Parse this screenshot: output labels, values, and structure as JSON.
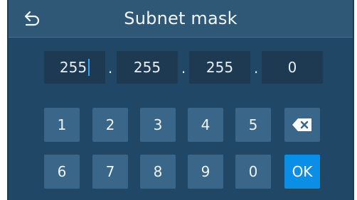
{
  "header": {
    "title": "Subnet mask",
    "back_icon": "back-arrow-icon"
  },
  "ip": {
    "octets": [
      "255",
      "255",
      "255",
      "0"
    ],
    "separator": "."
  },
  "keypad": {
    "row1": [
      "1",
      "2",
      "3",
      "4",
      "5"
    ],
    "row2": [
      "6",
      "7",
      "8",
      "9",
      "0"
    ],
    "backspace_icon": "backspace-icon",
    "ok_label": "OK"
  },
  "colors": {
    "background": "#214766",
    "header": "#2f5877",
    "key": "#3a6789",
    "ok": "#0b8fe6"
  }
}
